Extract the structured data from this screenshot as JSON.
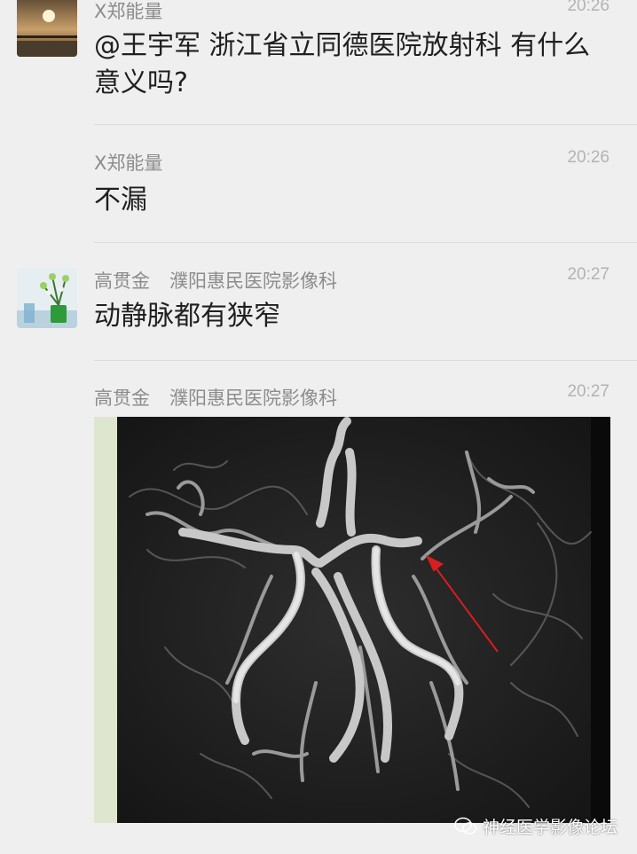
{
  "messages": [
    {
      "sender": "X郑能量",
      "department": "",
      "time": "20:26",
      "text": "@王宇军 浙江省立同德医院放射科 有什么意义吗?",
      "avatar": "sunset-avatar"
    },
    {
      "sender": "X郑能量",
      "department": "",
      "time": "20:26",
      "text": "不漏",
      "avatar": ""
    },
    {
      "sender": "高贯金",
      "department": "濮阳惠民医院影像科",
      "time": "20:27",
      "text": "动静脉都有狭窄",
      "avatar": "plant-avatar"
    },
    {
      "sender": "高贯金",
      "department": "濮阳惠民医院影像科",
      "time": "20:27",
      "text": "",
      "image": "brain-angiography-mra-image"
    }
  ],
  "watermark": {
    "text": "神经医学影像论坛",
    "icon": "wechat-channel-icon"
  },
  "colors": {
    "background": "#efefef",
    "sender": "#8c8c8c",
    "time": "#b3b3b3",
    "text": "#1f1f1f",
    "annotation_arrow": "#d81e1e"
  }
}
